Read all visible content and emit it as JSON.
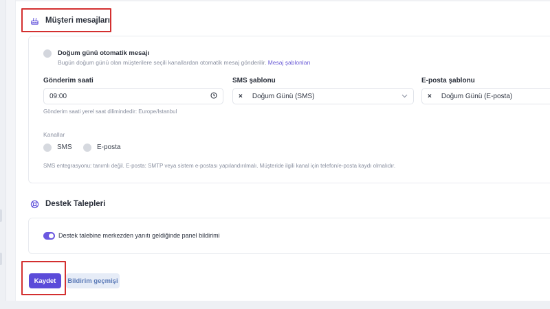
{
  "birthday_section": {
    "title": "Müşteri mesajları",
    "toggle_label": "Doğum günü otomatik mesajı",
    "toggle_desc": "Bugün doğum günü olan müşterilere seçili kanallardan otomatik mesaj gönderilir.",
    "templates_link": "Mesaj şablonları",
    "send_time": {
      "label": "Gönderim saati",
      "value": "09:00",
      "hint": "Gönderim saati yerel saat dilimindedir: Europe/Istanbul"
    },
    "sms_template": {
      "label": "SMS şablonu",
      "value": "Doğum Günü (SMS)"
    },
    "email_template": {
      "label": "E-posta şablonu",
      "value": "Doğum Günü (E-posta)"
    },
    "channels": {
      "label": "Kanallar",
      "sms": "SMS",
      "email": "E-posta"
    },
    "integration_note": "SMS entegrasyonu: tanımlı değil. E-posta: SMTP veya sistem e-postası yapılandırılmalı. Müşteride ilgili kanal için telefon/e-posta kaydı olmalıdır."
  },
  "support_section": {
    "title": "Destek Talepleri",
    "switch_label": "Destek talebine merkezden yanıtı geldiğinde panel bildirimi",
    "switch_on": true
  },
  "actions": {
    "save": "Kaydet",
    "history": "Bildirim geçmişi"
  },
  "colors": {
    "accent": "#5b4bd9",
    "highlight": "#d32f2f"
  }
}
